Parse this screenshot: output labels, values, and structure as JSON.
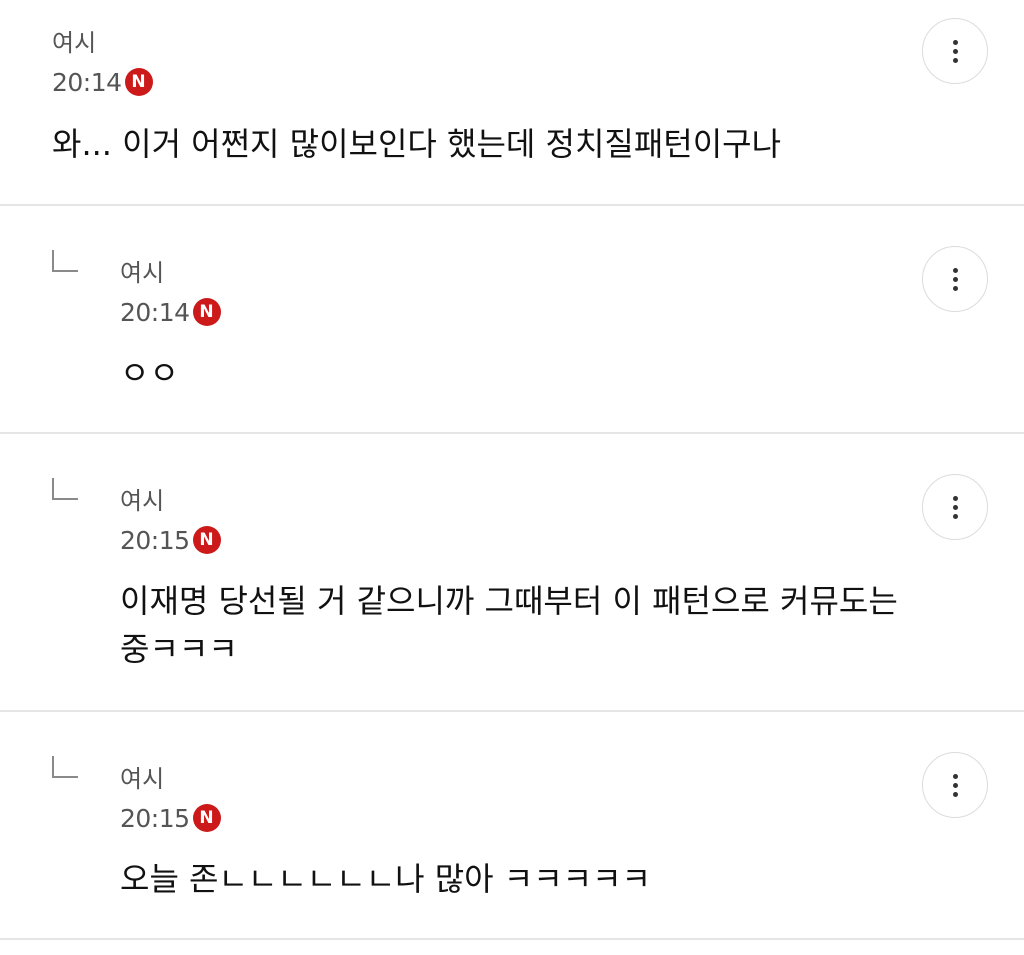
{
  "comments": [
    {
      "author": "여시",
      "time": "20:14",
      "badge": "N",
      "text": "와... 이거 어쩐지 많이보인다 했는데 정치질패턴이구나",
      "is_reply": false
    },
    {
      "author": "여시",
      "time": "20:14",
      "badge": "N",
      "text": "ㅇㅇ",
      "is_reply": true
    },
    {
      "author": "여시",
      "time": "20:15",
      "badge": "N",
      "text": "이재명 당선될 거 같으니까 그때부터 이 패턴으로 커뮤도는 중ㅋㅋㅋ",
      "is_reply": true
    },
    {
      "author": "여시",
      "time": "20:15",
      "badge": "N",
      "text": "오늘 존ㄴㄴㄴㄴㄴㄴ나 많아 ㅋㅋㅋㅋㅋ",
      "is_reply": true
    }
  ],
  "icons": {
    "more": "more-vertical-icon",
    "reply": "reply-arrow-icon",
    "new": "new-badge-icon"
  },
  "colors": {
    "badge": "#cc1a1a",
    "divider": "#e6e6e6",
    "meta_text": "#555555"
  }
}
